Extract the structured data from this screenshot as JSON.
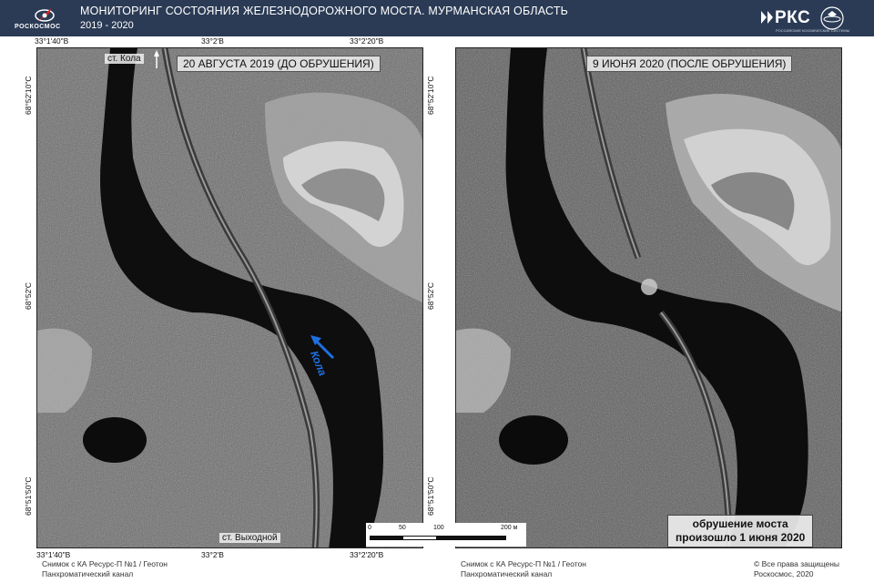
{
  "header": {
    "org_logo_text": "РОСКОСМОС",
    "title": "МОНИТОРИНГ СОСТОЯНИЯ ЖЕЛЕЗНОДОРОЖНОГО МОСТА. МУРМАНСКАЯ ОБЛАСТЬ",
    "years": "2019 - 2020",
    "right_logo": "РКС",
    "right_logo_sub": "РОССИЙСКИЕ КОСМИЧЕСКИЕ СИСТЕМЫ"
  },
  "coords": {
    "top": [
      "33°1'40\"В",
      "33°2'В",
      "33°2'20\"В"
    ],
    "bottom": [
      "33°1'40\"В",
      "33°2'В",
      "33°2'20\"В"
    ],
    "left": [
      "68°52'10\"С",
      "68°52'С",
      "68°51'50\"С"
    ],
    "right": [
      "68°52'10\"С",
      "68°52'С",
      "68°51'50\"С"
    ]
  },
  "left_panel": {
    "date_label": "20 АВГУСТА 2019 (ДО ОБРУШЕНИЯ)",
    "station_top": "ст. Кола",
    "station_bottom": "ст. Выходной",
    "river_label": "Кола"
  },
  "right_panel": {
    "date_label": "9 ИЮНЯ 2020 (ПОСЛЕ ОБРУШЕНИЯ)",
    "note_line1": "обрушение моста",
    "note_line2": "произошло 1 июня 2020"
  },
  "scale": {
    "ticks": [
      "0",
      "50",
      "100",
      "200 м"
    ]
  },
  "footer": {
    "left_line1": "Снимок с КА Ресурс-П №1 / Геотон",
    "left_line2": "Панхроматический канал",
    "mid_line1": "Снимок с КА Ресурс-П №1 / Геотон",
    "mid_line2": "Панхроматический канал",
    "right_line1": "© Все права защищены",
    "right_line2": "Роскосмос, 2020"
  },
  "colors": {
    "header_bg": "#2b3b55",
    "river_arrow": "#1e6fe0"
  }
}
